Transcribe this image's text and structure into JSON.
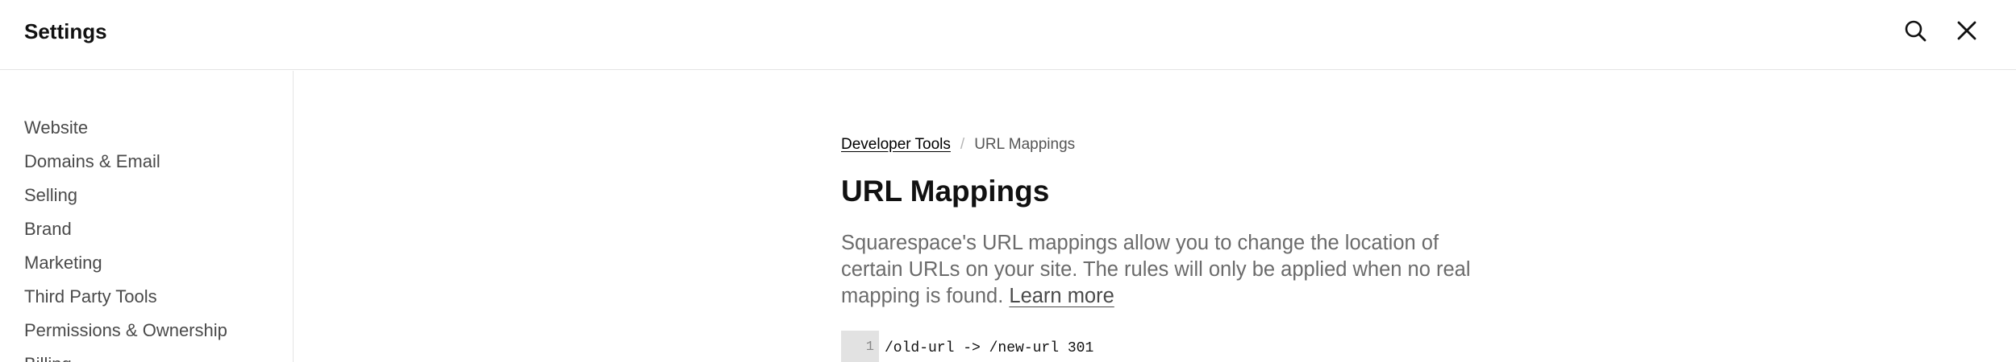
{
  "header": {
    "title": "Settings",
    "search_icon": "search-icon",
    "close_icon": "close-icon"
  },
  "sidebar": {
    "items": [
      {
        "label": "Website"
      },
      {
        "label": "Domains & Email"
      },
      {
        "label": "Selling"
      },
      {
        "label": "Brand"
      },
      {
        "label": "Marketing"
      },
      {
        "label": "Third Party Tools"
      },
      {
        "label": "Permissions & Ownership"
      },
      {
        "label": "Billing"
      }
    ]
  },
  "main": {
    "breadcrumb": {
      "parent": "Developer Tools",
      "separator": "/",
      "current": "URL Mappings"
    },
    "title": "URL Mappings",
    "description": "Squarespace's URL mappings allow you to change the location of certain URLs on your site. The rules will only be applied when no real mapping is found.",
    "learn_more": "Learn more",
    "editor": {
      "lines": [
        {
          "number": "1",
          "text": "/old-url -> /new-url 301"
        }
      ]
    }
  }
}
